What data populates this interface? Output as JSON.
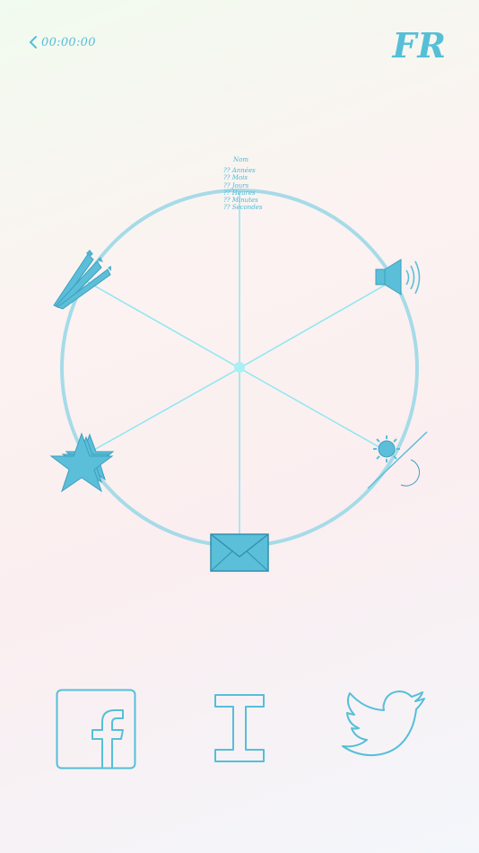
{
  "header": {
    "timer": "00:00:00",
    "language": "FR"
  },
  "countdown_info": {
    "name": "Nom",
    "lines": [
      "?? Années",
      "?? Mois",
      "?? Jours",
      "?? Heures",
      "?? Minutes",
      "?? Secondes"
    ]
  },
  "wheel_icons": [
    "pens-icon",
    "speaker-icon",
    "day-night-icon",
    "envelope-icon",
    "star-icon"
  ],
  "social": [
    "facebook-icon",
    "letter-i-icon",
    "twitter-icon"
  ],
  "colors": {
    "accent": "#55bfd8",
    "ring": "#9fdbe8",
    "spoke": "#8ee6f2",
    "icon_fill": "#5bbfd9",
    "icon_stroke": "#3e9fbe"
  }
}
